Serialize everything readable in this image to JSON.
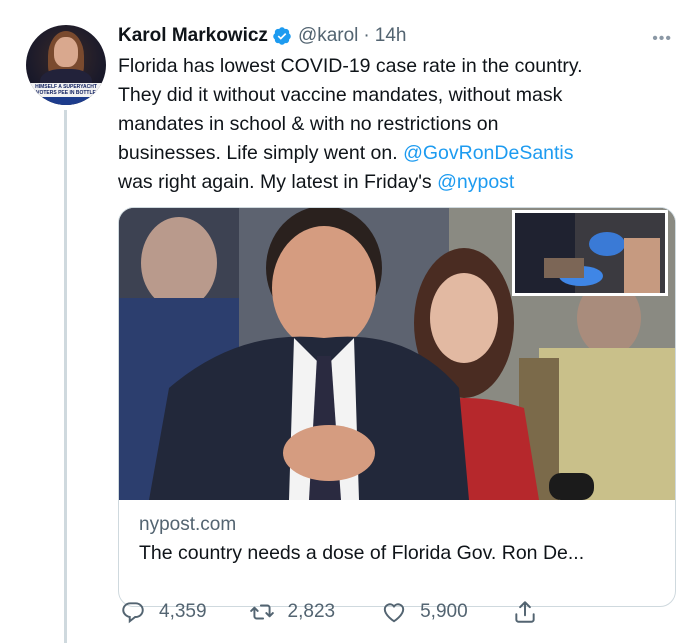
{
  "author": {
    "name": "Karol Markowicz",
    "handle": "@karol",
    "separator": "·",
    "time": "14h",
    "avatar_chyron": "HIMSELF A SUPERYACHT\nVOTERS PEE IN BOTTLE",
    "more_icon": "more-dots-icon",
    "verified_color": "#1d9bf0"
  },
  "tweet": {
    "text_segments": [
      "Florida has lowest COVID-19 case rate in the country.",
      "They did it without vaccine mandates, without mask",
      "mandates in school & with no restrictions on",
      "businesses. Life simply went on. ",
      "was right again. My latest in Friday's "
    ],
    "mention_1": "@GovRonDeSantis",
    "mention_2": "@nypost",
    "link_color": "#1d9bf0"
  },
  "card": {
    "domain": "nypost.com",
    "title": "The country needs a dose of Florida Gov. Ron De..."
  },
  "actions": {
    "replies": "4,359",
    "retweets": "2,823",
    "likes": "5,900",
    "reply_icon": "reply-icon",
    "retweet_icon": "retweet-icon",
    "like_icon": "heart-icon",
    "share_icon": "share-icon"
  }
}
